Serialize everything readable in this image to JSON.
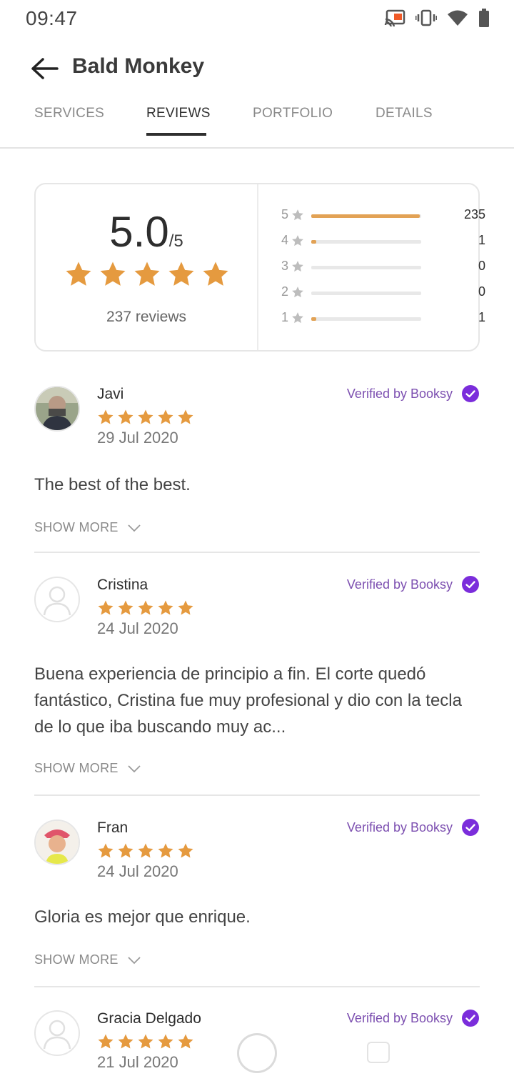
{
  "status_bar": {
    "time": "09:47",
    "icons": [
      "cast-icon",
      "vibrate-icon",
      "wifi-icon",
      "battery-icon"
    ]
  },
  "header": {
    "back_icon": "arrow-left-icon",
    "title": "Bald Monkey"
  },
  "tabs": [
    {
      "label": "SERVICES",
      "active": false
    },
    {
      "label": "REVIEWS",
      "active": true
    },
    {
      "label": "PORTFOLIO",
      "active": false
    },
    {
      "label": "DETAILS",
      "active": false
    }
  ],
  "rating_summary": {
    "score": "5.0",
    "out_of": "/5",
    "stars": 5,
    "reviews_count": "237 reviews",
    "distribution": [
      {
        "stars": "5",
        "count": "235",
        "fraction": 0.99
      },
      {
        "stars": "4",
        "count": "1",
        "fraction": 0.045
      },
      {
        "stars": "3",
        "count": "0",
        "fraction": 0
      },
      {
        "stars": "2",
        "count": "0",
        "fraction": 0
      },
      {
        "stars": "1",
        "count": "1",
        "fraction": 0.045
      }
    ]
  },
  "colors": {
    "star": "#e59a3f",
    "bar_fill": "#e2a255",
    "verified": "#7c4fb0",
    "check_circle": "#7b2ddb"
  },
  "reviews": [
    {
      "name": "Javi",
      "rating": 5,
      "date": "29 Jul 2020",
      "verified": "Verified by Booksy",
      "text": "The best of the best.",
      "show_more": "SHOW MORE",
      "avatar": "photo"
    },
    {
      "name": "Cristina",
      "rating": 5,
      "date": "24 Jul 2020",
      "verified": "Verified by Booksy",
      "text": "Buena experiencia de principio a fin. El corte quedó fantástico, Cristina fue muy profesional y dio con la tecla de lo que iba buscando muy ac...",
      "show_more": "SHOW MORE",
      "avatar": "placeholder"
    },
    {
      "name": "Fran",
      "rating": 5,
      "date": "24 Jul 2020",
      "verified": "Verified by Booksy",
      "text": "Gloria es mejor que enrique.",
      "show_more": "SHOW MORE",
      "avatar": "photo"
    },
    {
      "name": "Gracia Delgado",
      "rating": 5,
      "date": "21 Jul 2020",
      "verified": "Verified by Booksy",
      "text": "",
      "show_more": "",
      "avatar": "placeholder"
    }
  ]
}
